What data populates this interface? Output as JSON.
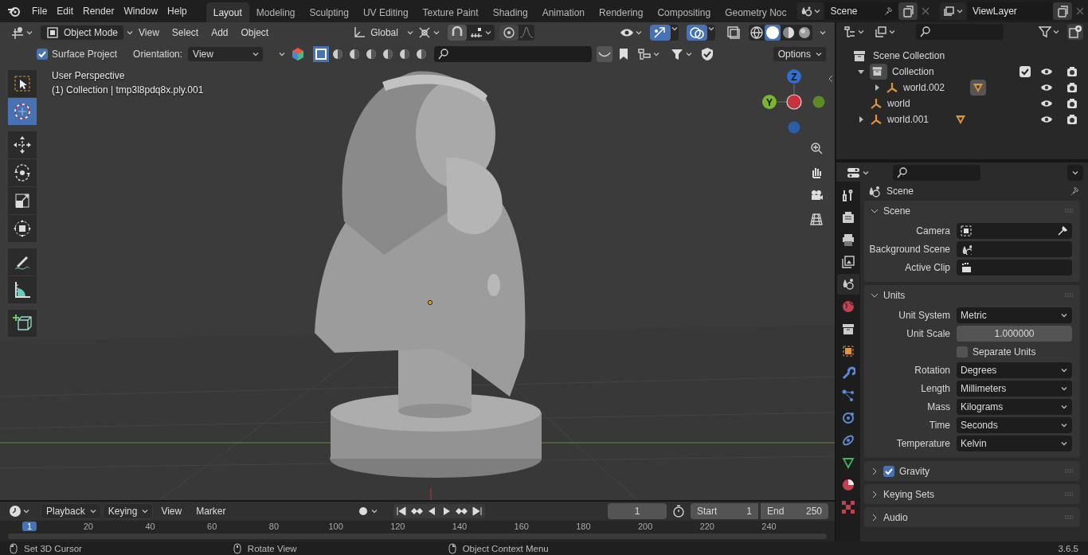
{
  "menu": [
    "File",
    "Edit",
    "Render",
    "Window",
    "Help"
  ],
  "workspaces": [
    {
      "label": "Layout",
      "selected": true
    },
    {
      "label": "Modeling",
      "selected": false
    },
    {
      "label": "Sculpting",
      "selected": false
    },
    {
      "label": "UV Editing",
      "selected": false
    },
    {
      "label": "Texture Paint",
      "selected": false
    },
    {
      "label": "Shading",
      "selected": false
    },
    {
      "label": "Animation",
      "selected": false
    },
    {
      "label": "Rendering",
      "selected": false
    },
    {
      "label": "Compositing",
      "selected": false
    },
    {
      "label": "Geometry Noc",
      "selected": false
    }
  ],
  "scene_selector": {
    "value": "Scene"
  },
  "view_layer_selector": {
    "value": "ViewLayer"
  },
  "viewport_header": {
    "mode": "Object Mode",
    "menus": [
      "View",
      "Select",
      "Add",
      "Object"
    ],
    "orientation": "Global"
  },
  "tool_settings": {
    "surface_project": {
      "label": "Surface Project",
      "checked": true
    },
    "orientation_label": "Orientation:",
    "orientation": "View",
    "options": "Options"
  },
  "viewport": {
    "info": [
      "User Perspective",
      "(1) Collection | tmp3l8pdq8x.ply.001"
    ],
    "tools": [
      {
        "kind": "select",
        "selected": false
      },
      {
        "kind": "cursor",
        "selected": true
      },
      {
        "kind": "move",
        "selected": false
      },
      {
        "kind": "rotate",
        "selected": false
      },
      {
        "kind": "scale",
        "selected": false
      },
      {
        "kind": "transform",
        "selected": false
      },
      {
        "kind": "annotate",
        "selected": false
      },
      {
        "kind": "measure",
        "selected": false
      },
      {
        "kind": "add_cube",
        "selected": false
      }
    ],
    "gizmo_axes": [
      "Z",
      "Y"
    ]
  },
  "outliner": {
    "root": "Scene Collection",
    "items": [
      {
        "label": "Collection",
        "kind": "collection",
        "expanded": true,
        "checked": true,
        "children": [
          {
            "label": "world.002",
            "kind": "object",
            "expanded": false,
            "mesh_selected": true
          }
        ]
      },
      {
        "label": "world",
        "kind": "object"
      },
      {
        "label": "world.001",
        "kind": "object",
        "expanded": false,
        "mesh_selected": false
      }
    ]
  },
  "properties": {
    "title": "Scene",
    "tabs": [
      {
        "kind": "tool",
        "selected": false
      },
      {
        "kind": "render",
        "selected": false
      },
      {
        "kind": "output",
        "selected": false
      },
      {
        "kind": "view_layer",
        "selected": false
      },
      {
        "kind": "scene",
        "selected": true
      },
      {
        "kind": "world",
        "selected": false
      },
      {
        "kind": "collection",
        "selected": false
      },
      {
        "kind": "object",
        "selected": false
      },
      {
        "kind": "modifiers",
        "selected": false
      },
      {
        "kind": "particles",
        "selected": false
      },
      {
        "kind": "physics",
        "selected": false
      },
      {
        "kind": "constraints",
        "selected": false
      },
      {
        "kind": "data",
        "selected": false
      },
      {
        "kind": "material",
        "selected": false
      },
      {
        "kind": "texture",
        "selected": false
      }
    ],
    "panels": [
      {
        "title": "Scene",
        "expanded": true,
        "rows": [
          {
            "kind": "camera_field",
            "label": "Camera"
          },
          {
            "kind": "scene_field",
            "label": "Background Scene"
          },
          {
            "kind": "clip_field",
            "label": "Active Clip"
          }
        ]
      },
      {
        "title": "Units",
        "expanded": true,
        "rows": [
          {
            "kind": "dropdown",
            "label": "Unit System",
            "value": "Metric"
          },
          {
            "kind": "number",
            "label": "Unit Scale",
            "value": "1.000000"
          },
          {
            "kind": "checkbox",
            "label": "Separate Units",
            "checked": false
          },
          {
            "kind": "dropdown",
            "label": "Rotation",
            "value": "Degrees"
          },
          {
            "kind": "dropdown",
            "label": "Length",
            "value": "Millimeters"
          },
          {
            "kind": "dropdown",
            "label": "Mass",
            "value": "Kilograms"
          },
          {
            "kind": "dropdown",
            "label": "Time",
            "value": "Seconds"
          },
          {
            "kind": "dropdown",
            "label": "Temperature",
            "value": "Kelvin"
          }
        ]
      },
      {
        "title": "Gravity",
        "expanded": false,
        "checked": true
      },
      {
        "title": "Keying Sets",
        "expanded": false
      },
      {
        "title": "Audio",
        "expanded": false
      }
    ]
  },
  "timeline": {
    "menus": [
      "Playback",
      "Keying",
      "View",
      "Marker"
    ],
    "current_frame": "1",
    "start_label": "Start",
    "start": "1",
    "end_label": "End",
    "end": "250",
    "ruler": [
      {
        "label": "1",
        "selected": true
      },
      {
        "label": "20",
        "selected": false
      },
      {
        "label": "40",
        "selected": false
      },
      {
        "label": "60",
        "selected": false
      },
      {
        "label": "80",
        "selected": false
      },
      {
        "label": "100",
        "selected": false
      },
      {
        "label": "120",
        "selected": false
      },
      {
        "label": "140",
        "selected": false
      },
      {
        "label": "160",
        "selected": false
      },
      {
        "label": "180",
        "selected": false
      },
      {
        "label": "200",
        "selected": false
      },
      {
        "label": "220",
        "selected": false
      },
      {
        "label": "240",
        "selected": false
      }
    ]
  },
  "status_bar": {
    "hints": [
      "Set 3D Cursor",
      "Rotate View",
      "Object Context Menu"
    ],
    "version": "3.6.5"
  }
}
